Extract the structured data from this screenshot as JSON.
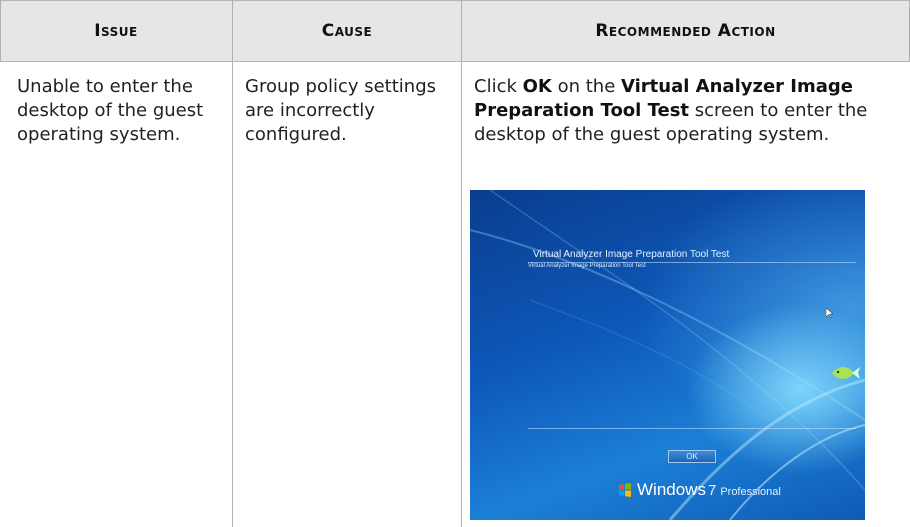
{
  "table": {
    "headers": [
      "Issue",
      "Cause",
      "Recommended Action"
    ],
    "row": {
      "issue": "Unable to enter the desktop of the guest operating system.",
      "cause": "Group policy settings are incorrectly configured.",
      "action": {
        "part1": "Click ",
        "ok_bold": "OK",
        "part2": " on the ",
        "screen_bold": "Virtual Analyzer Image Preparation Tool Test",
        "part3": " screen to enter the desktop of the guest operating system."
      }
    }
  },
  "screenshot": {
    "title": "Virtual Analyzer Image Preparation Tool Test",
    "subtitle": "Virtual Analyzer Image Preparation Tool Test",
    "ok_button": "OK",
    "brand_name": "Windows",
    "brand_version": "7",
    "brand_edition": "Professional",
    "icons": [
      "windows-flag-icon",
      "mouse-cursor-icon",
      "fish-icon"
    ]
  },
  "colors": {
    "header_bg": "#e6e6e6",
    "border": "#b0b0b0",
    "text": "#231f20",
    "desktop_blue": "#0d58b8"
  }
}
